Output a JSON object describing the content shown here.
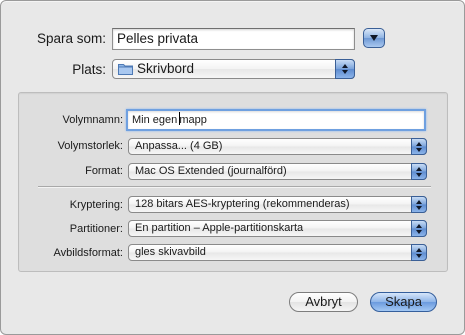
{
  "save_as": {
    "label": "Spara som:",
    "value": "Pelles privata"
  },
  "location": {
    "label": "Plats:",
    "value": "Skrivbord",
    "icon": "folder-icon"
  },
  "options": {
    "volume_name": {
      "label": "Volymnamn:",
      "value_before_caret": "Min egen ",
      "value_after_caret": "mapp"
    },
    "volume_size": {
      "label": "Volymstorlek:",
      "value": "Anpassa... (4 GB)"
    },
    "format": {
      "label": "Format:",
      "value": "Mac OS Extended (journalförd)"
    },
    "encryption": {
      "label": "Kryptering:",
      "value": "128 bitars AES-kryptering (rekommenderas)"
    },
    "partitions": {
      "label": "Partitioner:",
      "value": "En partition – Apple-partitionskarta"
    },
    "image_format": {
      "label": "Avbildsformat:",
      "value": "gles skivavbild"
    }
  },
  "buttons": {
    "cancel": "Avbryt",
    "create": "Skapa"
  },
  "colors": {
    "accent": "#6b9ade",
    "focus_ring": "#6fa0e0",
    "panel": "#e8e8e8"
  }
}
